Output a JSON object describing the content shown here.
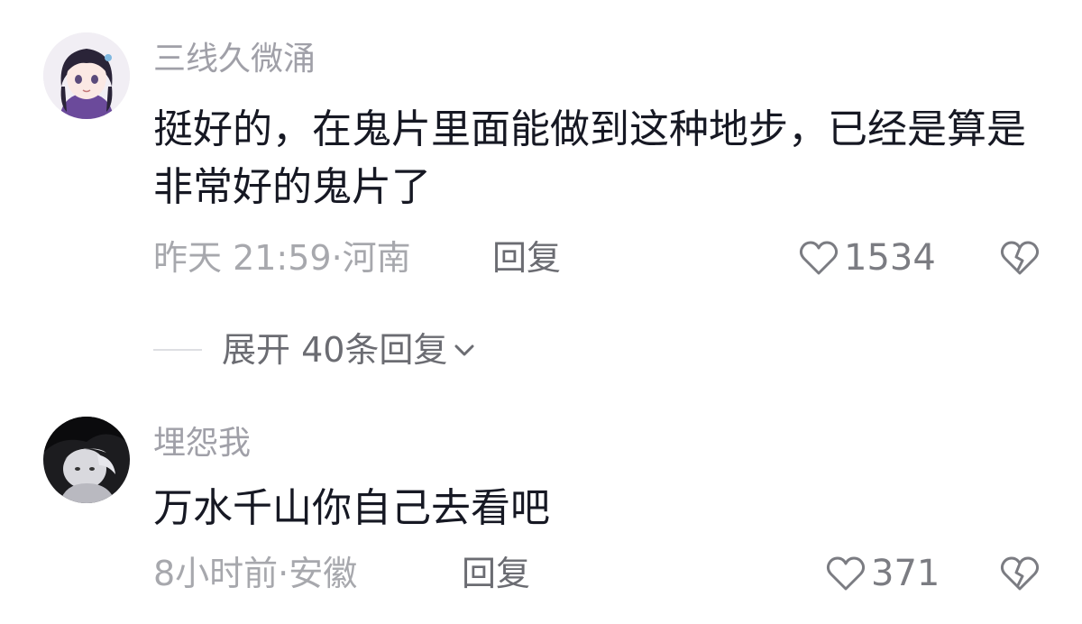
{
  "comments": [
    {
      "username": "三线久微涌",
      "content": "挺好的，在鬼片里面能做到这种地步，已经是算是非常好的鬼片了",
      "meta": "昨天 21:59·河南",
      "reply_label": "回复",
      "like_count": "1534",
      "avatar_icon": "anime-girl-avatar"
    },
    {
      "username": "埋怨我",
      "content": "万水千山你自己去看吧",
      "meta": "8小时前·安徽",
      "reply_label": "回复",
      "like_count": "371",
      "avatar_icon": "monochrome-portrait-avatar"
    }
  ],
  "expand_replies": {
    "label": "展开 40条回复"
  },
  "icons": {
    "like": "heart-outline-icon",
    "dislike": "broken-heart-icon",
    "expand": "chevron-down-icon"
  },
  "colors": {
    "text_primary": "#161823",
    "text_secondary": "#a7a8ad",
    "text_action": "#6b6c72"
  }
}
